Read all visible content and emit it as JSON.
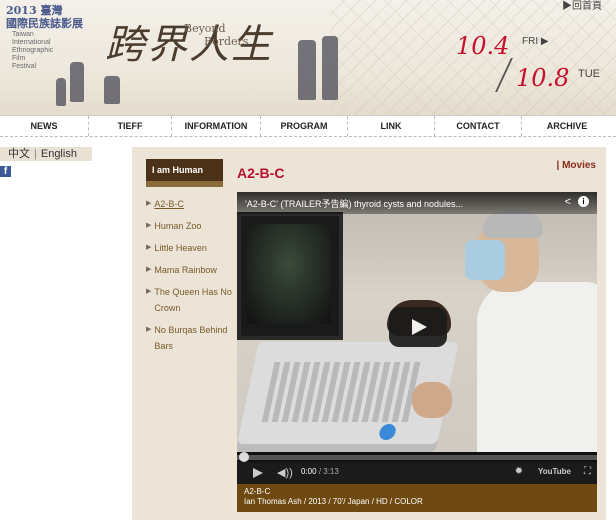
{
  "header": {
    "festival_zh_line1": "2013 臺灣",
    "festival_zh_line2": "國際民族誌影展",
    "festival_en": [
      "Taiwan",
      "International",
      "Ethnographic",
      "Film",
      "Festival"
    ],
    "home_link": "▶回首頁",
    "title_calligraphy": "跨界人生",
    "tagline_1": "Beyond",
    "tagline_2": "Borders",
    "date_start": "10.4",
    "day_start": "FRI ▶",
    "date_end": "10.8",
    "day_end": "TUE"
  },
  "nav": {
    "items": [
      "NEWS",
      "TIEFF",
      "INFORMATION",
      "PROGRAM",
      "LINK",
      "CONTACT",
      "ARCHIVE"
    ]
  },
  "lang": {
    "zh": "中文",
    "separator": "|",
    "en": "English"
  },
  "social": {
    "facebook": "f"
  },
  "sidebar": {
    "title": "I am Human",
    "items": [
      {
        "label": "A2-B-C",
        "icon": "arrow-right-icon"
      },
      {
        "label": "Human Zoo",
        "icon": "arrow-right-icon"
      },
      {
        "label": "Little Heaven",
        "icon": "arrow-right-icon"
      },
      {
        "label": "Mama Rainbow",
        "icon": "arrow-right-icon"
      },
      {
        "label": "The Queen Has No Crown",
        "icon": "arrow-right-icon"
      },
      {
        "label": "No Burqas Behind Bars",
        "icon": "arrow-right-icon"
      }
    ],
    "arrow": "▶"
  },
  "main": {
    "title": "A2-B-C",
    "category": "| Movies"
  },
  "video": {
    "title": "'A2-B-C' (TRAILER予告編) thyroid cysts and nodules...",
    "share_icon": "<",
    "info_icon": "i",
    "current_time": "0:00",
    "duration": "/ 3:13",
    "volume_icon": "◀))",
    "settings_icon": "✹",
    "youtube_logo": "YouTube",
    "fullscreen_icon": "⛶",
    "progress": 0
  },
  "caption": {
    "title": "A2-B-C",
    "credits": "Ian Thomas Ash / 2013 / 70'/ Japan / HD / COLOR"
  },
  "colors": {
    "accent_red": "#c8102e",
    "sidebar_brown": "#4a3118",
    "caption_brown": "#6e4a12",
    "panel_beige": "#ebe4d7"
  }
}
